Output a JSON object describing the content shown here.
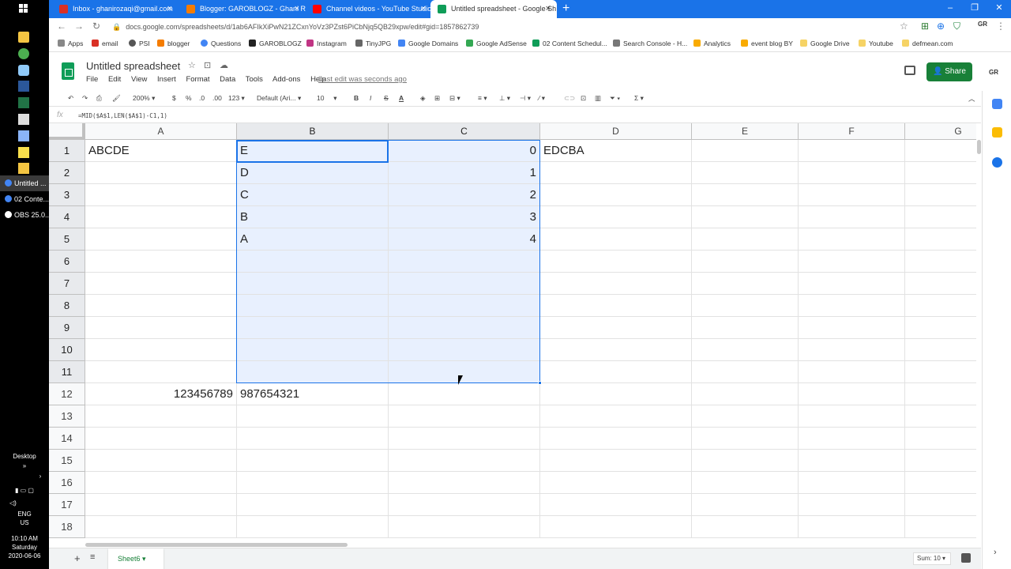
{
  "taskbar": {
    "apps": [
      {
        "label": "Untitled ...",
        "active": true
      },
      {
        "label": "02 Conte...",
        "active": false
      },
      {
        "label": "OBS 25.0....",
        "active": false
      }
    ],
    "desktop_label": "Desktop",
    "lang": "ENG",
    "region": "US",
    "time": "10:10 AM",
    "day": "Saturday",
    "date": "2020-06-06"
  },
  "browser": {
    "tabs": [
      {
        "label": "Inbox - ghanirozaqi@gmail.com",
        "color": "#d93025"
      },
      {
        "label": "Blogger: GAROBLOGZ - Ghani Ro",
        "color": "#f57c00"
      },
      {
        "label": "Channel videos - YouTube Studio",
        "color": "#ff0000"
      },
      {
        "label": "Untitled spreadsheet - Google Sh",
        "color": "#0f9d58"
      }
    ],
    "url": "docs.google.com/spreadsheets/d/1ab6AFIkXiPwN21ZCxnYoVz3PZst6PiCbNjq5QB29xpw/edit#gid=1857862739",
    "bookmarks": [
      "Apps",
      "email",
      "PSI",
      "blogger",
      "Questions",
      "GAROBLOGZ",
      "Instagram",
      "TinyJPG",
      "Google Domains",
      "Google AdSense",
      "02 Content Schedul...",
      "Search Console - H...",
      "Analytics",
      "event blog BY",
      "Google Drive",
      "Youtube",
      "defmean.com"
    ]
  },
  "sheets": {
    "title": "Untitled spreadsheet",
    "menus": [
      "File",
      "Edit",
      "View",
      "Insert",
      "Format",
      "Data",
      "Tools",
      "Add-ons",
      "Help"
    ],
    "last_edit": "Last edit was seconds ago",
    "share_label": "Share",
    "avatar": "GR",
    "toolbar": {
      "zoom": "200%",
      "currency": "$",
      "percent": "%",
      "dec_less": ".0",
      "dec_more": ".00",
      "more_formats": "123",
      "font": "Default (Ari...",
      "font_size": "10",
      "bold": "B",
      "italic": "I",
      "strike": "S",
      "text_color": "A",
      "sum": "Σ"
    },
    "formula": "=MID($A$1,LEN($A$1)-C1,1)",
    "fx": "fx",
    "columns": [
      "A",
      "B",
      "C",
      "D",
      "E",
      "F",
      "G"
    ],
    "rows": [
      "1",
      "2",
      "3",
      "4",
      "5",
      "6",
      "7",
      "8",
      "9",
      "10",
      "11",
      "12",
      "13",
      "14",
      "15",
      "16",
      "17",
      "18"
    ],
    "cells": {
      "A1": "ABCDE",
      "B1": "E",
      "C1": "0",
      "D1": "EDCBA",
      "B2": "D",
      "C2": "1",
      "B3": "C",
      "C3": "2",
      "B4": "B",
      "C4": "3",
      "B5": "A",
      "C5": "4",
      "A12": "123456789",
      "B12": "987654321"
    },
    "sheet_tab": "Sheet6",
    "sum_label": "Sum: 10"
  },
  "colors": {
    "accent": "#1a73e8",
    "sheets_green": "#188038",
    "selection_fill": "#e8f0fe"
  }
}
